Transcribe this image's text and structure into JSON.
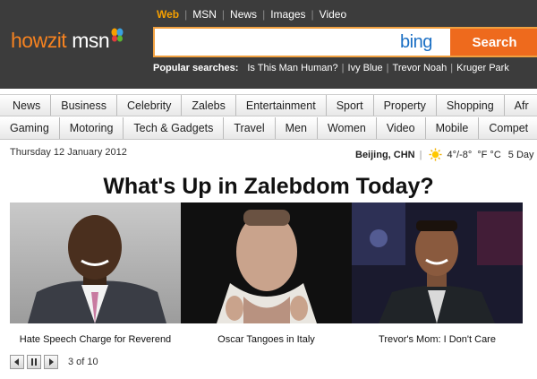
{
  "brand": {
    "left": "howzit",
    "right": "msn"
  },
  "scope_tabs": [
    "Web",
    "MSN",
    "News",
    "Images",
    "Video"
  ],
  "search": {
    "placeholder": "",
    "engine": "bing",
    "button": "Search"
  },
  "popular": {
    "label": "Popular searches:",
    "items": [
      "Is This Man Human?",
      "Ivy Blue",
      "Trevor Noah",
      "Kruger Park"
    ]
  },
  "nav_primary": [
    "News",
    "Business",
    "Celebrity",
    "Zalebs",
    "Entertainment",
    "Sport",
    "Property",
    "Shopping",
    "Afr"
  ],
  "nav_secondary": [
    "Gaming",
    "Motoring",
    "Tech & Gadgets",
    "Travel",
    "Men",
    "Women",
    "Video",
    "Mobile",
    "Compet"
  ],
  "date": "Thursday 12 January 2012",
  "weather": {
    "city": "Beijing, CHN",
    "temps": "4°/-8°",
    "units": "°F °C",
    "forecast": "5 Day",
    "icon": "sun-icon"
  },
  "feature": {
    "headline": "What's Up in Zalebdom Today?",
    "captions": [
      "Hate Speech Charge for Reverend",
      "Oscar Tangoes in Italy",
      "Trevor's Mom: I Don't Care"
    ],
    "pager": "3 of 10"
  },
  "colors": {
    "header_bg": "#3c3c3c",
    "accent_orange": "#ee6a1d",
    "active_tab": "#f6a000",
    "bing_blue": "#1a6fc4"
  }
}
